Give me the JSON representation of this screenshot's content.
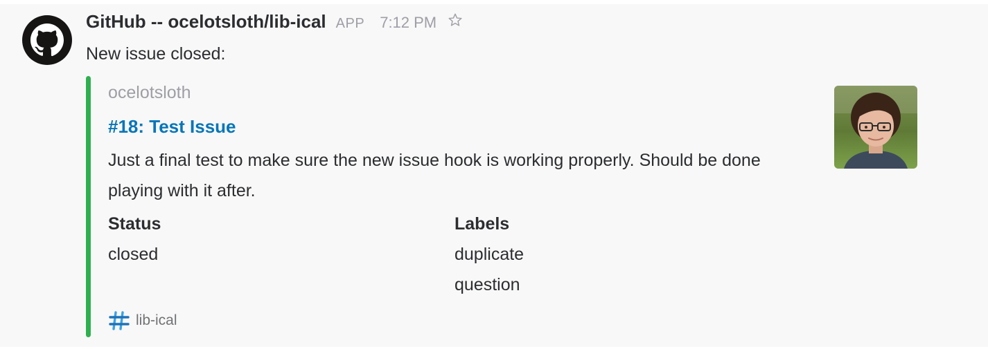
{
  "message": {
    "sender": "GitHub -- ocelotsloth/lib-ical",
    "app_badge": "APP",
    "time": "7:12 PM",
    "text": "New issue closed:",
    "avatar_icon": "github-octocat-icon",
    "star_icon": "star-outline-icon"
  },
  "attachment": {
    "bar_color": "#2eb04f",
    "author": "ocelotsloth",
    "title": "#18: Test Issue",
    "body": "Just a final test to make sure the new issue hook is working properly. Should be done playing with it after.",
    "fields": {
      "status": {
        "title": "Status",
        "value": "closed"
      },
      "labels": {
        "title": "Labels",
        "values": [
          "duplicate",
          "question"
        ]
      }
    },
    "footer": {
      "icon": "repo-hash-icon",
      "text": "lib-ical"
    },
    "thumb_icon": "user-photo"
  },
  "colors": {
    "link": "#0576b9",
    "text": "#2c2d30",
    "muted": "#9e9ea6"
  }
}
